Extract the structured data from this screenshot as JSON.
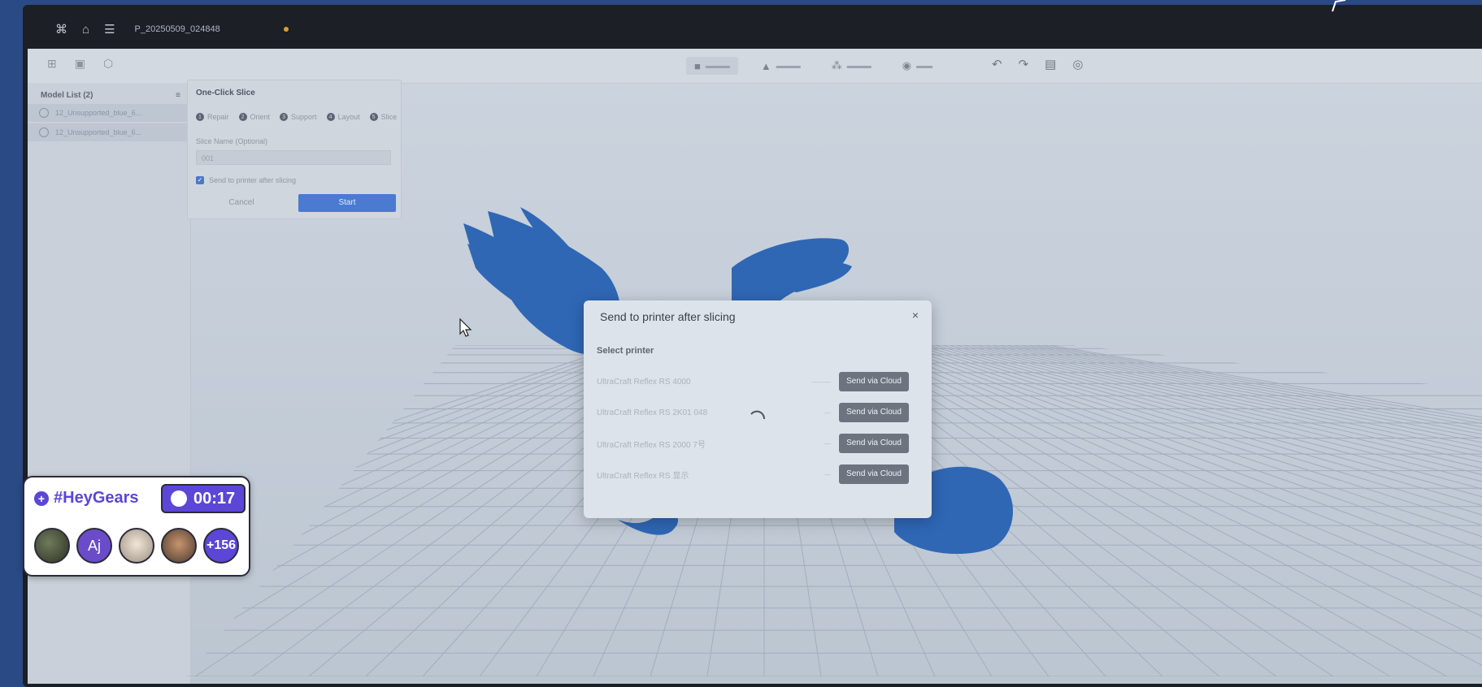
{
  "titlebar": {
    "file_name": "P_20250509_024848"
  },
  "sidebar": {
    "header": "Model List (2)",
    "items": [
      {
        "label": "12_Unsupported_blue_6..."
      },
      {
        "label": "12_Unsupported_blue_6..."
      }
    ]
  },
  "slice_panel": {
    "title": "One-Click Slice",
    "steps": [
      {
        "num": "1",
        "label": "Repair"
      },
      {
        "num": "2",
        "label": "Orient"
      },
      {
        "num": "3",
        "label": "Support"
      },
      {
        "num": "4",
        "label": "Layout"
      },
      {
        "num": "5",
        "label": "Slice"
      }
    ],
    "slice_name_label": "Slice Name (Optional)",
    "slice_name_value": "001",
    "send_checkbox_label": "Send to printer after slicing",
    "cancel_label": "Cancel",
    "start_label": "Start"
  },
  "dialog": {
    "title": "Send to printer after slicing",
    "close": "×",
    "subtitle": "Select printer",
    "printers": [
      {
        "name": "UltraCraft Reflex RS 4000",
        "status": "———",
        "button": "Send via Cloud"
      },
      {
        "name": "UltraCraft Reflex RS 2K01 048",
        "status": "—",
        "button": "Send via Cloud"
      },
      {
        "name": "UltraCraft Reflex RS 2000 7号",
        "status": "—",
        "button": "Send via Cloud"
      },
      {
        "name": "UltraCraft Reflex RS 显示",
        "status": "—",
        "button": "Send via Cloud"
      }
    ]
  },
  "overlay": {
    "hashtag": "#HeyGears",
    "timer": "00:17",
    "avatar_initials": "Aj",
    "extra_count": "+156"
  },
  "colors": {
    "model_blue": "#2f67b5",
    "accent_purple": "#5b46d8",
    "start_blue": "#4a7bd0"
  }
}
